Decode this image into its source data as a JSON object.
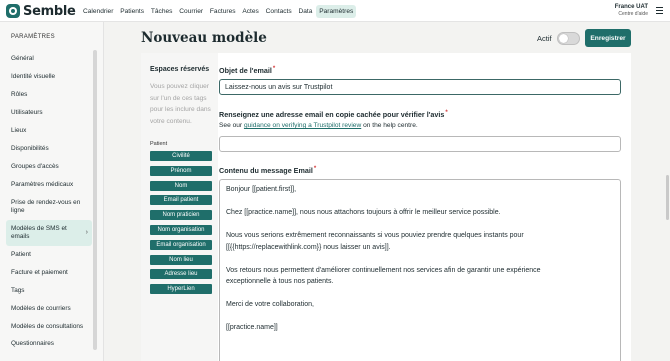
{
  "app": {
    "name": "Semble"
  },
  "nav": {
    "items": [
      "Calendrier",
      "Patients",
      "Tâches",
      "Courrier",
      "Factures",
      "Actes",
      "Contacts",
      "Data",
      "Paramètres"
    ],
    "active": "Paramètres"
  },
  "org": {
    "name": "France UAT",
    "sub": "Centre d'aide"
  },
  "sidebar": {
    "title": "PARAMÈTRES",
    "items": [
      {
        "label": "Général"
      },
      {
        "label": "Identité visuelle"
      },
      {
        "label": "Rôles"
      },
      {
        "label": "Utilisateurs"
      },
      {
        "label": "Lieux"
      },
      {
        "label": "Disponibilités"
      },
      {
        "label": "Groupes d'accès"
      },
      {
        "label": "Paramètres médicaux"
      },
      {
        "label": "Prise de rendez-vous en ligne"
      },
      {
        "label": "Modèles de SMS et emails",
        "active": true
      },
      {
        "label": "Patient"
      },
      {
        "label": "Facture et paiement"
      },
      {
        "label": "Tags"
      },
      {
        "label": "Modèles de courriers"
      },
      {
        "label": "Modèles de consultations"
      },
      {
        "label": "Questionnaires"
      }
    ]
  },
  "header": {
    "title": "Nouveau modèle",
    "actif_label": "Actif",
    "actif_on": false,
    "save_label": "Enregistrer"
  },
  "placeholders": {
    "title": "Espaces réservés",
    "description": "Vous pouvez cliquer sur l'un de ces tags pour les inclure dans votre contenu.",
    "group": "Patient",
    "tags": [
      "Civilité",
      "Prénom",
      "Nom",
      "Email patient",
      "Nom praticien",
      "Nom organisation",
      "Email organisation",
      "Nom lieu",
      "Adresse lieu",
      "HyperLien"
    ]
  },
  "form": {
    "subject_label": "Objet de l'email",
    "subject_value": "Laissez-nous un avis sur Trustpilot",
    "bcc_label": "Renseignez une adresse email en copie cachée pour vérifier l'avis",
    "bcc_help_prefix": "See our ",
    "bcc_help_link": "guidance on verifying a Trustpilot review",
    "bcc_help_suffix": " on the help centre.",
    "bcc_value": "",
    "body_label": "Contenu du message Email",
    "body_lines": [
      "Bonjour [[patient.first]],",
      "",
      "Chez [[practice.name]], nous nous attachons toujours à offrir le meilleur service possible.",
      "",
      "Nous vous serions extrêmement reconnaissants si vous pouviez prendre quelques instants pour",
      "[[{{https://replacewithlink.com}} nous laisser un avis]].",
      "",
      "Vos retours nous permettent d'améliorer continuellement nos services afin de garantir une expérience",
      "exceptionnelle à tous nos patients.",
      "",
      "Merci de votre collaboration,",
      "",
      "[[practice.name]]"
    ],
    "required_mark": "*"
  },
  "colors": {
    "brand": "#1f6e6a",
    "active_bg": "#dceee9",
    "required": "#d43a3a"
  }
}
